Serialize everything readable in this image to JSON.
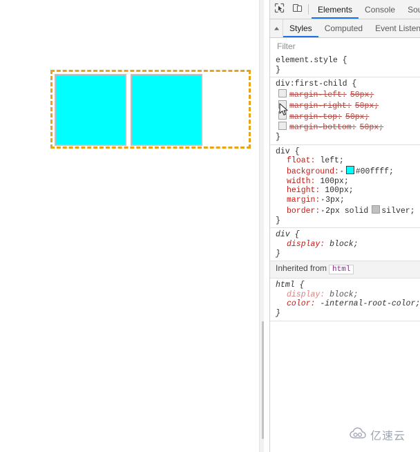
{
  "page": {
    "container_name": "dashed-float-container",
    "boxes": [
      {
        "label": "float-box-1"
      },
      {
        "label": "float-box-2"
      }
    ],
    "colors": {
      "box_background": "#00ffff",
      "box_border": "#c0c0c0",
      "container_dash": "#e8a317"
    }
  },
  "devtools": {
    "toolbar": {
      "inspect_icon": "inspect-element-icon",
      "device_icon": "device-toolbar-icon"
    },
    "main_tabs": [
      {
        "label": "Elements",
        "active": true
      },
      {
        "label": "Console",
        "active": false
      },
      {
        "label": "Sou",
        "active": false
      }
    ],
    "sub_tabs": [
      {
        "label": "Styles",
        "active": true
      },
      {
        "label": "Computed",
        "active": false
      },
      {
        "label": "Event Listener",
        "active": false
      }
    ],
    "scroll_up_icon": "chevron-up-icon",
    "filter": {
      "placeholder": "Filter",
      "value": ""
    },
    "rules": [
      {
        "selector": "element.style {",
        "close": "}",
        "ua": false,
        "declarations": []
      },
      {
        "selector": "div:first-child {",
        "close": "}",
        "ua": false,
        "declarations": [
          {
            "checkbox": true,
            "disabled": true,
            "property": "margin-left:",
            "value": "50px;"
          },
          {
            "checkbox": true,
            "disabled": true,
            "property": "margin-right:",
            "value": "50px;"
          },
          {
            "checkbox": true,
            "disabled": true,
            "property": "margin-top:",
            "value": "50px;"
          },
          {
            "checkbox": true,
            "disabled": true,
            "property": "margin-bottom:",
            "value": "50px;"
          }
        ]
      },
      {
        "selector": "div {",
        "close": "}",
        "ua": false,
        "declarations": [
          {
            "property": "float:",
            "value": "left;"
          },
          {
            "property": "background:",
            "value": "#00ffff;",
            "expand": true,
            "swatch": "#00ffff"
          },
          {
            "property": "width:",
            "value": "100px;"
          },
          {
            "property": "height:",
            "value": "100px;"
          },
          {
            "property": "margin:",
            "value": "3px;",
            "expand": true
          },
          {
            "property": "border:",
            "value": "2px solid",
            "value2": "silver;",
            "expand": true,
            "swatch": "#c0c0c0"
          }
        ]
      },
      {
        "selector": "div {",
        "close": "}",
        "ua": true,
        "declarations": [
          {
            "property": "display:",
            "value": "block;"
          }
        ]
      }
    ],
    "inherited": {
      "label": "Inherited from",
      "chip": "html"
    },
    "inherited_rule": {
      "selector": "html {",
      "close": "}",
      "ua": true,
      "declarations": [
        {
          "property": "display:",
          "value": "block;",
          "faded": true
        },
        {
          "property": "color:",
          "value": "-internal-root-color;"
        }
      ]
    }
  },
  "watermark": {
    "icon": "cloud-logo-icon",
    "text": "亿速云"
  }
}
